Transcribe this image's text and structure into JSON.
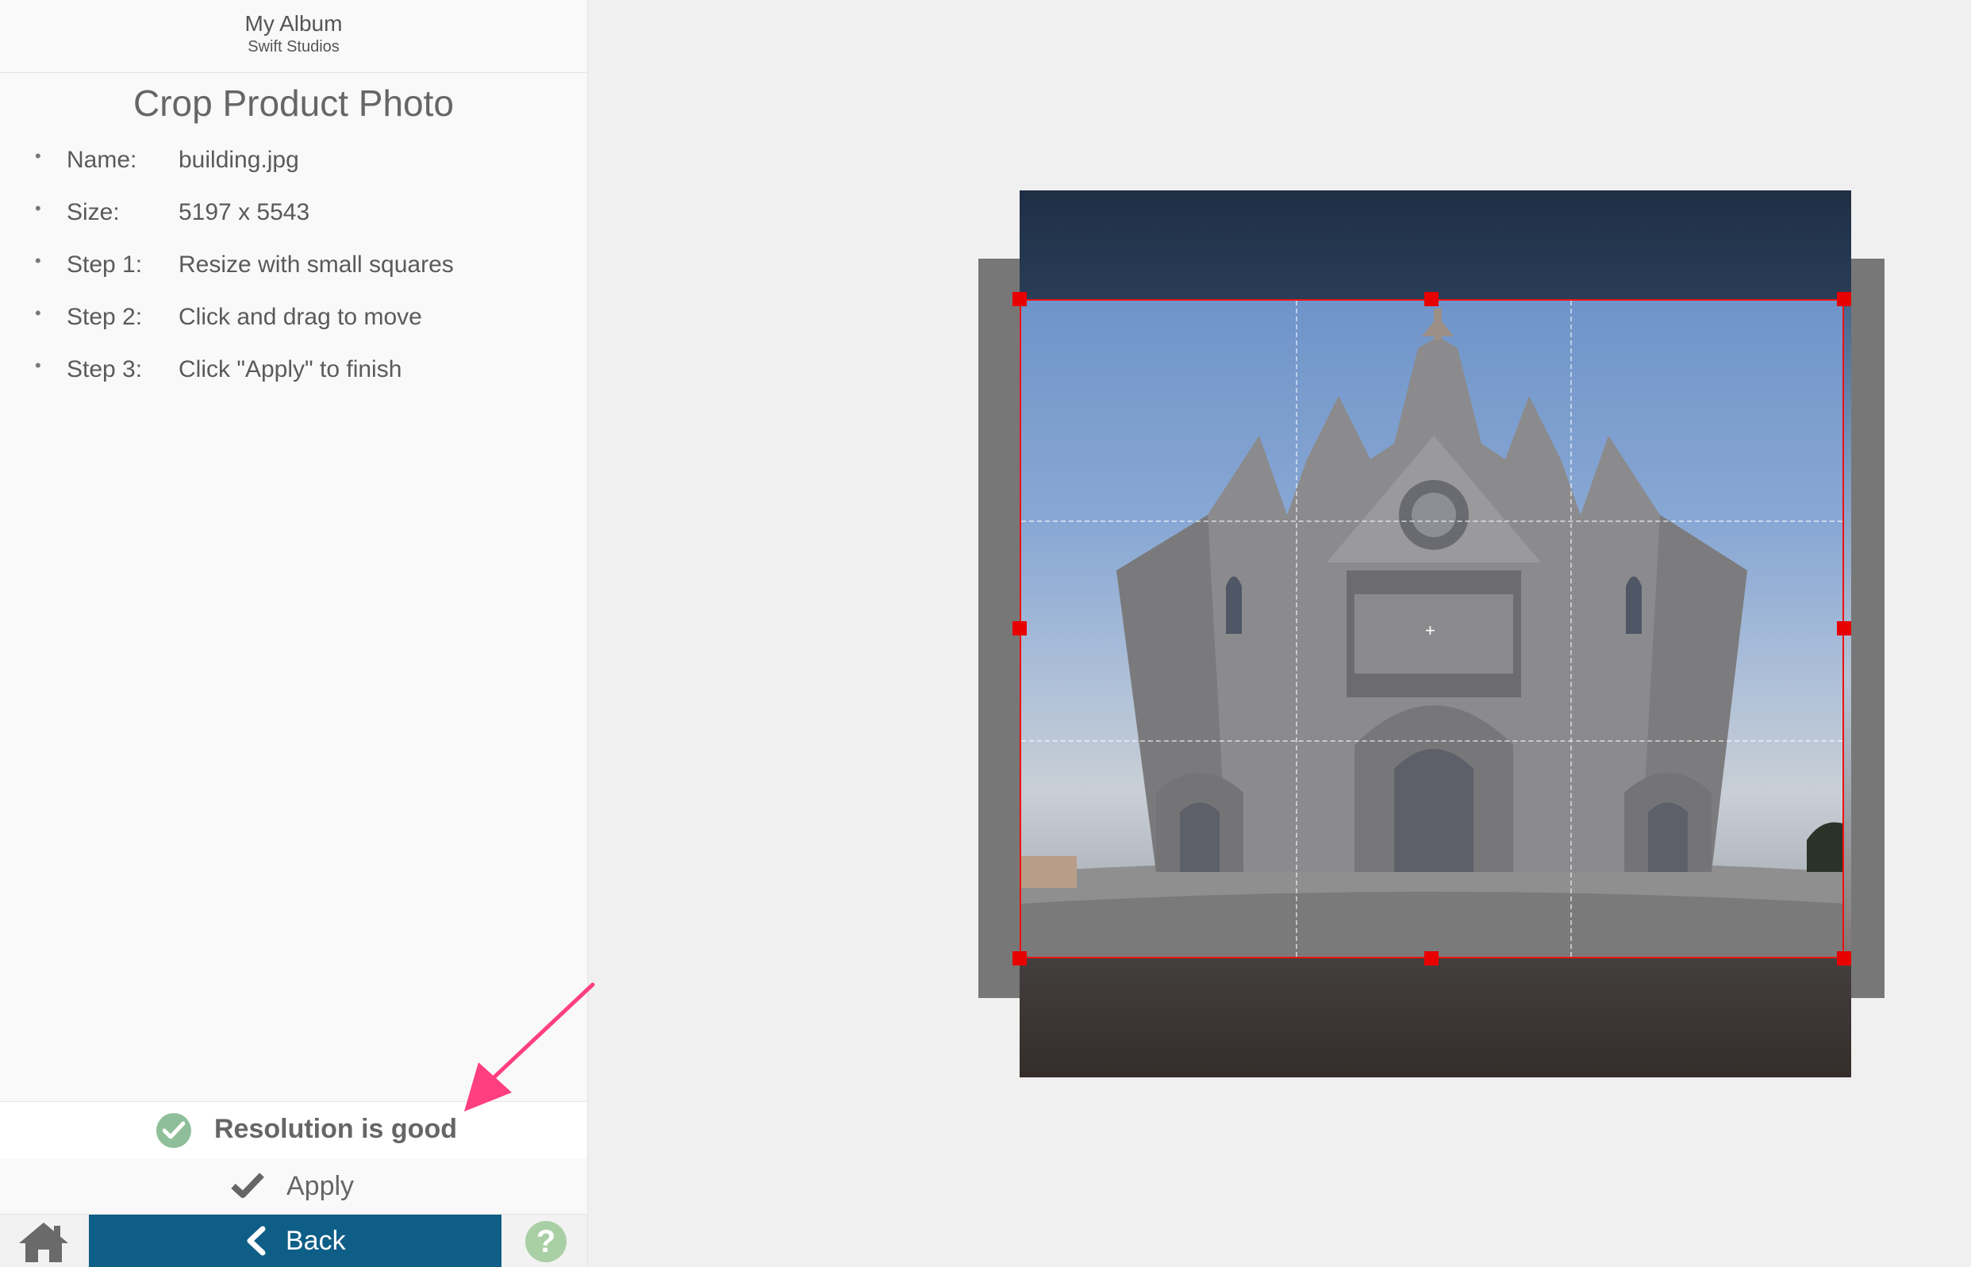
{
  "header": {
    "title": "My Album",
    "subtitle": "Swift Studios"
  },
  "page_title": "Crop Product Photo",
  "info": [
    {
      "label": "Name:",
      "value": "building.jpg"
    },
    {
      "label": "Size:",
      "value": "5197 x 5543"
    },
    {
      "label": "Step 1:",
      "value": "Resize with small squares"
    },
    {
      "label": "Step 2:",
      "value": "Click and drag to move"
    },
    {
      "label": "Step 3:",
      "value": "Click \"Apply\" to finish"
    }
  ],
  "status": {
    "text": "Resolution is good",
    "color": "#8fbf9a"
  },
  "actions": {
    "apply_label": "Apply",
    "back_label": "Back",
    "help_label": "?"
  },
  "icons": {
    "home": "home-icon",
    "check_circle": "check-circle-icon",
    "apply": "checkmark-icon",
    "back": "chevron-left-icon",
    "help": "question-icon"
  },
  "colors": {
    "accent": "#0f5e87",
    "crop_border": "#e11111",
    "annotation": "#ff3f7f",
    "help": "#a9cfa4"
  }
}
